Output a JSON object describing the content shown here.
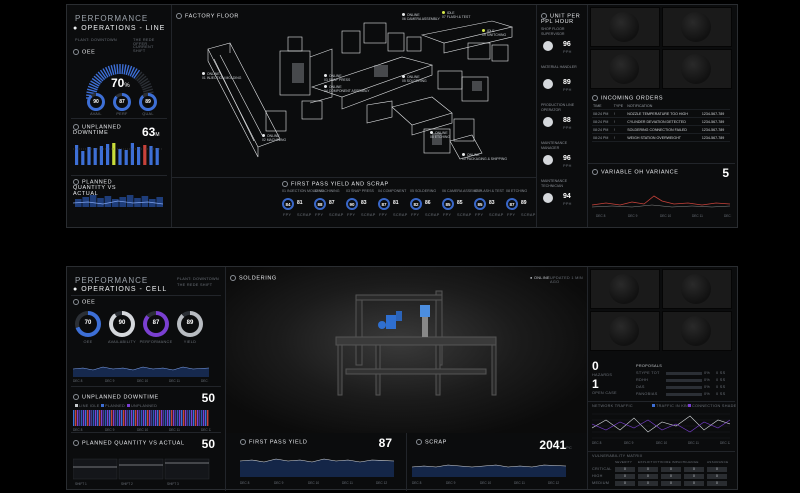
{
  "colors": {
    "accent": "#3d6fd6",
    "accent_light": "#7fa3ee",
    "warning": "#c9dd3a",
    "alert": "#c8423a",
    "purple": "#7a3fd1"
  },
  "line": {
    "title": "PERFORMANCE",
    "subtitle": "OPERATIONS - LINE",
    "meta_left": "PLANT: DOWNTOWN",
    "meta_right": "THE REDE OFFER",
    "meta_sub": "CURRENT SHIFT",
    "oee": {
      "label": "OEE",
      "value": "70",
      "unit": "%",
      "rings": [
        {
          "value": "90",
          "label": "AVAIL"
        },
        {
          "value": "87",
          "label": "PERF"
        },
        {
          "value": "89",
          "label": "QUAL"
        }
      ]
    },
    "downtime": {
      "label": "UNPLANNED DOWNTIME",
      "value": "63",
      "unit": "M"
    },
    "planned": {
      "label": "PLANNED QUANTITY VS ACTUAL"
    },
    "floor": {
      "label": "FACTORY FLOOR",
      "stations": [
        {
          "name": "01 INJECTION MOLDING",
          "status": "ONLINE"
        },
        {
          "name": "02 MACHINING",
          "status": "ONLINE"
        },
        {
          "name": "03 SNAP PRESS",
          "status": "ONLINE"
        },
        {
          "name": "04 COMPONENT ASSEMBLY",
          "status": "ONLINE"
        },
        {
          "name": "05 SOLDERING",
          "status": "ONLINE"
        },
        {
          "name": "06 CAMERA ASSEMBLY",
          "status": "ONLINE"
        },
        {
          "name": "07 FLASH & TEST",
          "status": "IDLE"
        },
        {
          "name": "08 ETCHING",
          "status": "ONLINE"
        },
        {
          "name": "09 SWITCHING",
          "status": "IDLE"
        },
        {
          "name": "10 PACKAGING & SHIPPING",
          "status": "ONLINE"
        }
      ]
    },
    "fpy": {
      "label": "FIRST PASS YIELD AND SCRAP",
      "items": [
        {
          "name": "01 INJECTION MOLDING",
          "ring": "84",
          "val": "81"
        },
        {
          "name": "02 MACHINING",
          "ring": "88",
          "val": "87"
        },
        {
          "name": "03 SNAP PRESS",
          "ring": "90",
          "val": "83"
        },
        {
          "name": "04 COMPONENT",
          "ring": "87",
          "val": "81"
        },
        {
          "name": "05 SOLDERING",
          "ring": "82",
          "val": "86"
        },
        {
          "name": "06 CAMERA ASSEMBLY",
          "ring": "85",
          "val": "85"
        },
        {
          "name": "07 FLASH & TEST",
          "ring": "85",
          "val": "83"
        },
        {
          "name": "08 ETCHING",
          "ring": "87",
          "val": "89"
        }
      ],
      "foot_ring": "FPY",
      "foot_val": "SCRAP"
    },
    "unit_per_ppl": {
      "label": "UNIT PER PPL HOUR",
      "items": [
        {
          "role": "SHOP FLOOR SUPERVISOR",
          "value": "96"
        },
        {
          "role": "MATERIAL HANDLER",
          "value": "89"
        },
        {
          "role": "PRODUCTION LINE OPERATOR",
          "value": "88"
        },
        {
          "role": "MAINTENANCE MANAGER",
          "value": "96"
        },
        {
          "role": "MAINTENANCE TECHNICIAN",
          "value": "94"
        }
      ],
      "unit": "PPH"
    },
    "orders": {
      "label": "INCOMING ORDERS",
      "headers": [
        "TIME",
        "TYPE",
        "NOTIFICATION",
        ""
      ],
      "rows": [
        [
          "08:24 PM",
          "!",
          "NOZZLE TEMPERATURE TOO HIGH",
          "1234-567-789"
        ],
        [
          "08:24 PM",
          "!",
          "CYLINDER DEVIATION DETECTED",
          "1234-567-789"
        ],
        [
          "08:24 PM",
          "!",
          "SOLDERING CONNECTION FAILED",
          "1234-567-789"
        ],
        [
          "08:24 PM",
          "!",
          "WEIGH STATION OVERWEIGHT",
          "1234-567-789"
        ]
      ]
    },
    "variance": {
      "label": "VARIABLE OH VARIANCE",
      "value": "5"
    }
  },
  "cell": {
    "title": "PERFORMANCE",
    "subtitle": "OPERATIONS - CELL",
    "meta": "PLANT: DOWNTOWN",
    "meta2": "THE REDE SHIFT",
    "oee": {
      "label": "OEE",
      "rings": [
        {
          "value": "70",
          "label": "OEE"
        },
        {
          "value": "90",
          "label": "AVAILABILITY"
        },
        {
          "value": "87",
          "label": "PERFORMANCE"
        },
        {
          "value": "89",
          "label": "YIELD"
        }
      ]
    },
    "downtime": {
      "label": "UNPLANNED DOWNTIME",
      "value": "50",
      "legend": [
        "LINE IDLE",
        "PLANNED",
        "UNPLANNED"
      ]
    },
    "planned": {
      "label": "PLANNED QUANTITY VS ACTUAL",
      "value": "50",
      "shifts": [
        "SHIFT 1",
        "SHIFT 2",
        "SHIFT 3"
      ]
    },
    "soldering": {
      "label": "SOLDERING",
      "online": "ONLINE",
      "meta": "UPDATED 1 MIN AGO"
    },
    "fpy": {
      "label": "FIRST PASS YIELD",
      "value": "87"
    },
    "scrap": {
      "label": "SCRAP",
      "value": "2041",
      "unit": "PC"
    },
    "ticks": [
      "DEC 8",
      "DEC 9",
      "DEC 10",
      "DEC 11",
      "DEC 12"
    ],
    "counters": [
      {
        "value": "0",
        "label": "HAZARDS"
      },
      {
        "value": "1",
        "label": "OPEN CASE"
      }
    ],
    "proposals": {
      "label": "PROPOSALS",
      "rows": [
        {
          "name": "STYPE TOT",
          "pct": "0%",
          "val": "0 SS"
        },
        {
          "name": "RDHH",
          "pct": "0%",
          "val": "0 SS"
        },
        {
          "name": "DAS",
          "pct": "0%",
          "val": "0 SS"
        },
        {
          "name": "PANOBIAS",
          "pct": "0%",
          "val": "0 SS"
        }
      ]
    },
    "network": {
      "label": "NETWORK TRAFFIC",
      "legend": [
        "TRAFFIC IN KBS",
        "CONNECTION SHADE"
      ]
    },
    "vuln": {
      "label": "VULNERABILITY MATRIX",
      "headers": [
        "",
        "SEVERITY",
        "EXPLOITIVITY",
        "CORE IMPACT",
        "CHANGE",
        "ASSURANCE"
      ],
      "rows": [
        "CRITICAL",
        "HIGH",
        "MEDIUM"
      ],
      "cell": "0"
    }
  }
}
